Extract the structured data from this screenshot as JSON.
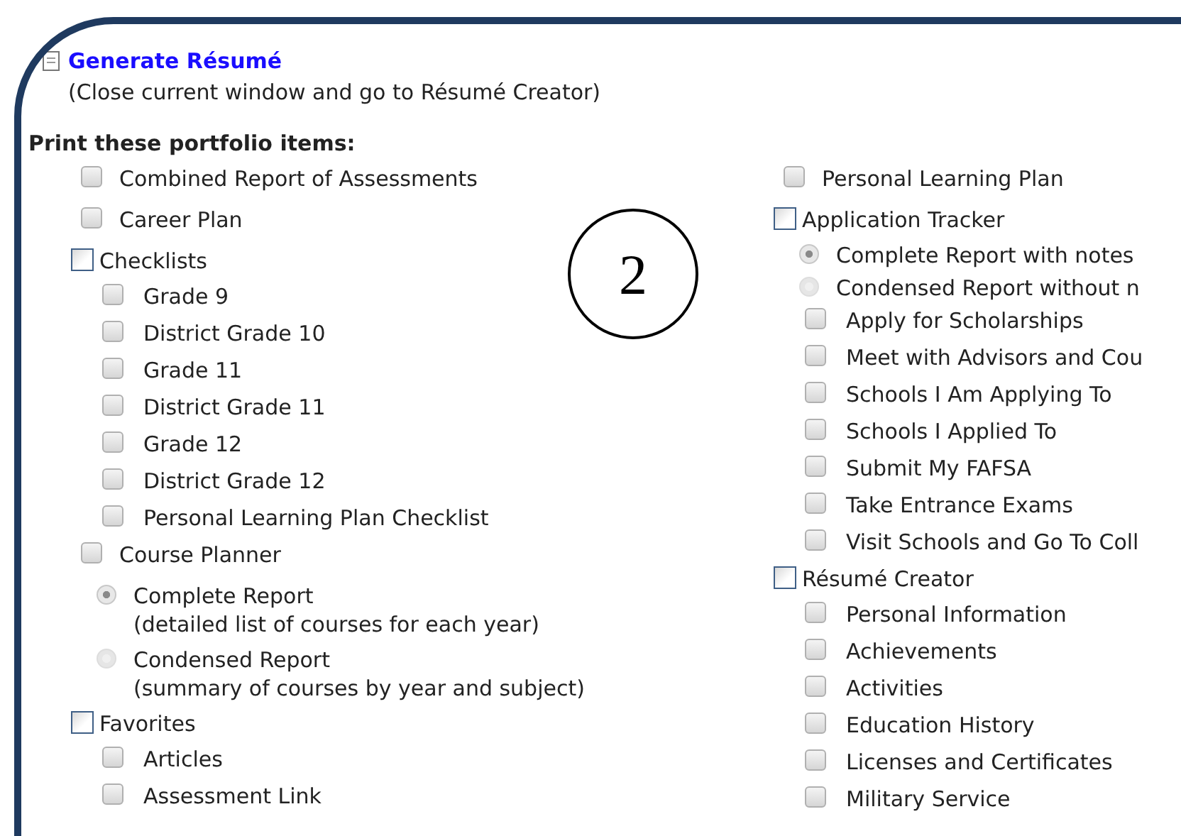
{
  "header": {
    "link": "Generate Résumé",
    "note": "(Close current window and go to Résumé Creator)"
  },
  "section_title": "Print these portfolio items:",
  "annotation": {
    "label": "2"
  },
  "columns": [
    [
      {
        "kind": "checkbox",
        "label": "Combined Report of Assessments",
        "checked": false
      },
      {
        "kind": "checkbox",
        "label": "Career Plan",
        "checked": false
      },
      {
        "kind": "group",
        "label": "Checklists",
        "checked": false,
        "children": [
          {
            "kind": "checkbox",
            "label": "Grade 9",
            "checked": false
          },
          {
            "kind": "checkbox",
            "label": "District Grade 10",
            "checked": false
          },
          {
            "kind": "checkbox",
            "label": "Grade 11",
            "checked": false
          },
          {
            "kind": "checkbox",
            "label": "District Grade 11",
            "checked": false
          },
          {
            "kind": "checkbox",
            "label": "Grade 12",
            "checked": false
          },
          {
            "kind": "checkbox",
            "label": "District Grade 12",
            "checked": false
          },
          {
            "kind": "checkbox",
            "label": "Personal Learning Plan Checklist",
            "checked": false
          }
        ]
      },
      {
        "kind": "checkbox",
        "label": "Course Planner",
        "checked": false,
        "children": [
          {
            "kind": "radio",
            "label": "Complete Report",
            "note": "(detailed list of courses for each year)",
            "selected": true
          },
          {
            "kind": "radio",
            "label": "Condensed Report",
            "note": "(summary of courses by year and subject)",
            "selected": false
          }
        ]
      },
      {
        "kind": "group",
        "label": "Favorites",
        "checked": false,
        "children": [
          {
            "kind": "checkbox",
            "label": "Articles",
            "checked": false
          },
          {
            "kind": "checkbox",
            "label": "Assessment Link",
            "checked": false
          }
        ]
      }
    ],
    [
      {
        "kind": "checkbox",
        "label": "Personal Learning Plan",
        "checked": false
      },
      {
        "kind": "group",
        "label": "Application Tracker",
        "checked": false,
        "children": [
          {
            "kind": "radio",
            "label": "Complete Report with notes",
            "selected": true
          },
          {
            "kind": "radio",
            "label": "Condensed Report without n",
            "selected": false
          },
          {
            "kind": "checkbox",
            "label": "Apply for Scholarships",
            "checked": false
          },
          {
            "kind": "checkbox",
            "label": "Meet with Advisors and Cou",
            "checked": false
          },
          {
            "kind": "checkbox",
            "label": "Schools I Am Applying To",
            "checked": false
          },
          {
            "kind": "checkbox",
            "label": "Schools I Applied To",
            "checked": false
          },
          {
            "kind": "checkbox",
            "label": "Submit My FAFSA",
            "checked": false
          },
          {
            "kind": "checkbox",
            "label": "Take Entrance Exams",
            "checked": false
          },
          {
            "kind": "checkbox",
            "label": "Visit Schools and Go To Coll",
            "checked": false
          }
        ]
      },
      {
        "kind": "group",
        "label": "Résumé Creator",
        "checked": false,
        "children": [
          {
            "kind": "checkbox",
            "label": "Personal Information",
            "checked": false
          },
          {
            "kind": "checkbox",
            "label": "Achievements",
            "checked": false
          },
          {
            "kind": "checkbox",
            "label": "Activities",
            "checked": false
          },
          {
            "kind": "checkbox",
            "label": "Education History",
            "checked": false
          },
          {
            "kind": "checkbox",
            "label": "Licenses and Certificates",
            "checked": false
          },
          {
            "kind": "checkbox",
            "label": "Military Service",
            "checked": false
          }
        ]
      }
    ]
  ]
}
